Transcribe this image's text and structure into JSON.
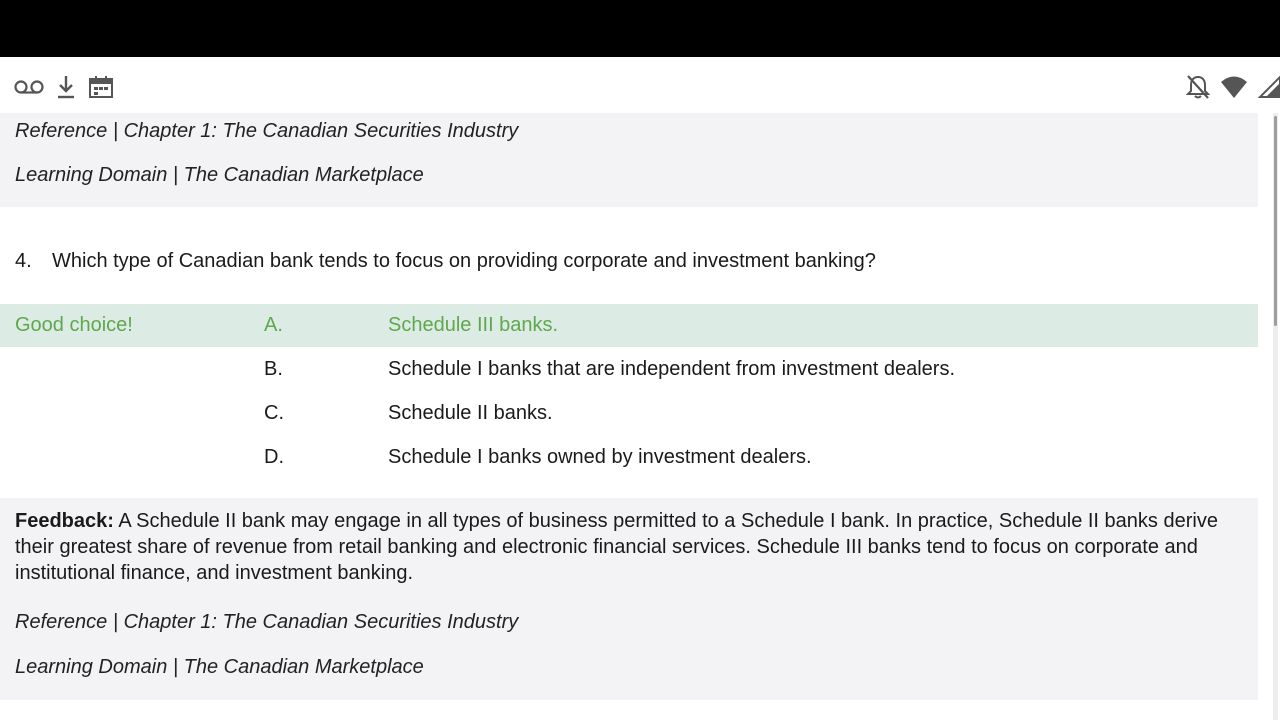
{
  "status_bar": {
    "left_icons": [
      "voicemail-icon",
      "download-icon",
      "calendar-icon"
    ],
    "right_icons": [
      "notifications-off-icon",
      "wifi-icon",
      "signal-icon"
    ]
  },
  "top_reference": {
    "reference": "Reference | Chapter 1: The Canadian Securities Industry",
    "learning_domain": "Learning Domain | The Canadian Marketplace"
  },
  "question": {
    "number": "4.",
    "text": "Which type of Canadian bank tends to focus on providing corporate and investment banking?"
  },
  "choices": [
    {
      "verdict": "Good choice!",
      "letter": "A.",
      "text": "Schedule III banks.",
      "selected": true
    },
    {
      "verdict": "",
      "letter": "B.",
      "text": "Schedule I banks that are independent from investment dealers.",
      "selected": false
    },
    {
      "verdict": "",
      "letter": "C.",
      "text": "Schedule II banks.",
      "selected": false
    },
    {
      "verdict": "",
      "letter": "D.",
      "text": "Schedule I banks owned by investment dealers.",
      "selected": false
    }
  ],
  "feedback": {
    "label": "Feedback:",
    "text": "A Schedule II bank may engage in all types of business permitted to a Schedule I bank. In practice, Schedule II banks derive their greatest share of revenue from retail banking and electronic financial services. Schedule III banks tend to focus on corporate and institutional finance, and investment banking."
  },
  "bottom_reference": {
    "reference": "Reference | Chapter 1: The Canadian Securities Industry",
    "learning_domain": "Learning Domain | The Canadian Marketplace"
  },
  "colors": {
    "correct_text": "#5fa84e",
    "correct_row_bg": "#dcebe4",
    "reference_bg": "#f3f3f5"
  }
}
